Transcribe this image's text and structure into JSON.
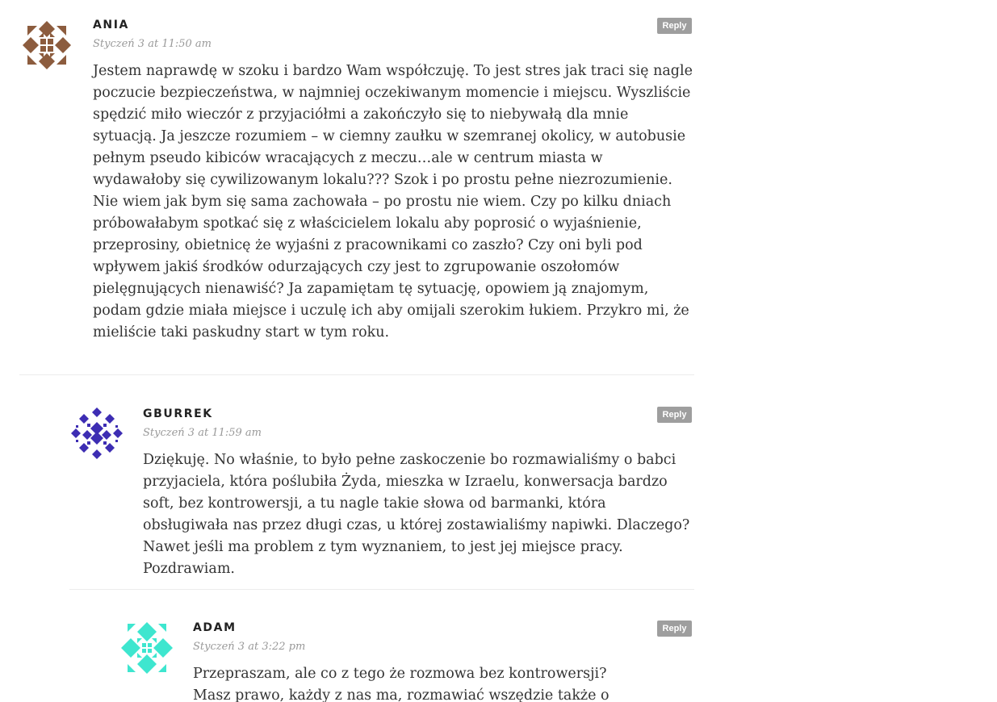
{
  "comments": [
    {
      "author": "ANIA",
      "date": "Styczeń 3 at 11:50 am",
      "reply_label": "Reply",
      "avatar_color": "#8c5c3e",
      "text": "Jestem naprawdę w szoku i bardzo Wam współczuję. To jest stres jak traci się nagle poczucie bezpieczeństwa, w najmniej oczekiwanym momencie i miejscu. Wyszliście spędzić miło wieczór z przyjaciółmi a zakończyło się to niebywałą dla mnie sytuacją. Ja jeszcze rozumiem – w ciemny zaułku w szemranej okolicy, w autobusie pełnym pseudo kibiców wracających z meczu…ale w centrum miasta w wydawałoby się cywilizowanym lokalu??? Szok i po prostu pełne niezrozumienie. Nie wiem jak bym się sama zachowała – po prostu nie wiem. Czy po kilku dniach próbowałabym spotkać się z właścicielem lokalu aby poprosić o wyjaśnienie, przeprosiny, obietnicę że wyjaśni z pracownikami co zaszło? Czy oni byli pod wpływem jakiś środków odurzających czy jest to zgrupowanie oszołomów pielęgnujących nienawiść? Ja zapamiętam tę sytuację, opowiem ją znajomym, podam gdzie miała miejsce i uczulę ich aby omijali szerokim łukiem. Przykro mi, że mieliście taki paskudny start w tym roku."
    },
    {
      "author": "GBURREK",
      "date": "Styczeń 3 at 11:59 am",
      "reply_label": "Reply",
      "avatar_color": "#3d2db3",
      "text": "Dziękuję. No właśnie, to było pełne zaskoczenie bo rozmawialiśmy o babci przyjaciela, która poślubiła Żyda, mieszka w Izraelu, konwersacja bardzo soft, bez kontrowersji, a tu nagle takie słowa od barmanki, która obsługiwała nas przez długi czas, u której zostawialiśmy napiwki. Dlaczego? Nawet jeśli ma problem z tym wyznaniem, to jest jej miejsce pracy. Pozdrawiam."
    },
    {
      "author": "ADAM",
      "date": "Styczeń 3 at 3:22 pm",
      "reply_label": "Reply",
      "avatar_color": "#3ee6cf",
      "text": "Przepraszam, ale co z tego że rozmowa bez kontrowersji? Masz prawo, każdy z nas ma, rozmawiać wszędzie także o"
    }
  ]
}
